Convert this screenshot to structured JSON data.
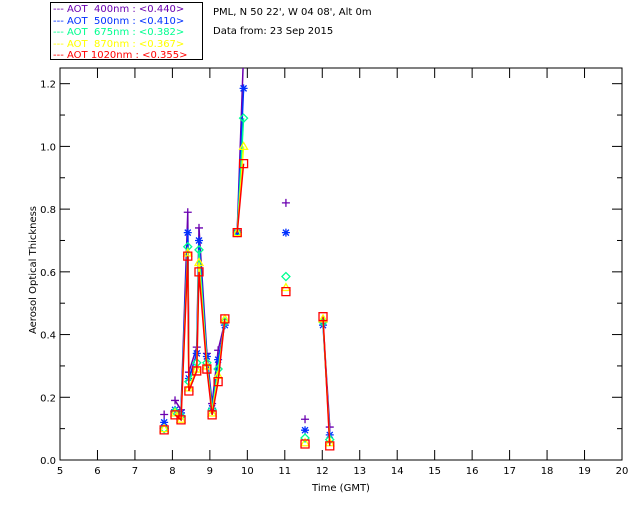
{
  "header": {
    "site": "PML, N 50 22', W 04 08', Alt 0m",
    "date": "Data from: 23 Sep 2015"
  },
  "legend": [
    {
      "label": "AOT  400nm : <0.440>",
      "color": "#6a00b0"
    },
    {
      "label": "AOT  500nm : <0.410>",
      "color": "#0030ff"
    },
    {
      "label": "AOT  675nm : <0.382>",
      "color": "#00ff90"
    },
    {
      "label": "AOT  870nm : <0.367>",
      "color": "#ffff00"
    },
    {
      "label": "AOT 1020nm : <0.355>",
      "color": "#ff0000"
    }
  ],
  "chart_data": {
    "type": "line",
    "xlabel": "Time (GMT)",
    "ylabel": "Aerosol Optical Thickness",
    "xlim": [
      5,
      20
    ],
    "ylim": [
      0,
      1.25
    ],
    "xticks": [
      5,
      6,
      7,
      8,
      9,
      10,
      11,
      12,
      13,
      14,
      15,
      16,
      17,
      18,
      19,
      20
    ],
    "yticks": [
      "0.0",
      "0.2",
      "0.4",
      "0.6",
      "0.8",
      "1.0",
      "1.2"
    ],
    "grid": false,
    "x": [
      7.78,
      8.07,
      8.23,
      8.41,
      8.44,
      8.65,
      8.71,
      8.92,
      9.06,
      9.22,
      9.4,
      9.73,
      9.9,
      11.03,
      11.54,
      12.02,
      12.2
    ],
    "connected_segments": [
      [
        1,
        10
      ],
      [
        11,
        12
      ],
      [
        15,
        16
      ]
    ],
    "series": [
      {
        "name": "AOT  400nm",
        "marker": "plus",
        "color": "#6a00b0",
        "values": [
          0.145,
          0.19,
          0.16,
          0.79,
          0.28,
          0.36,
          0.74,
          0.34,
          0.18,
          0.35,
          0.44,
          0.73,
          1.3,
          0.82,
          0.13,
          0.44,
          0.105
        ]
      },
      {
        "name": "AOT  500nm",
        "marker": "asterisk",
        "color": "#0030ff",
        "values": [
          0.12,
          0.16,
          0.15,
          0.725,
          0.26,
          0.34,
          0.7,
          0.33,
          0.165,
          0.32,
          0.43,
          0.725,
          1.185,
          0.725,
          0.095,
          0.43,
          0.08
        ]
      },
      {
        "name": "AOT  675nm",
        "marker": "diamond",
        "color": "#00ff90",
        "values": [
          0.1,
          0.155,
          0.14,
          0.68,
          0.25,
          0.31,
          0.67,
          0.31,
          0.16,
          0.29,
          0.44,
          0.725,
          1.09,
          0.585,
          0.07,
          0.44,
          0.065
        ]
      },
      {
        "name": "AOT  870nm",
        "marker": "triangle",
        "color": "#ffff00",
        "values": [
          0.1,
          0.15,
          0.13,
          0.66,
          0.23,
          0.29,
          0.63,
          0.3,
          0.15,
          0.27,
          0.45,
          0.725,
          1.0,
          0.55,
          0.055,
          0.45,
          0.055
        ]
      },
      {
        "name": "AOT 1020nm",
        "marker": "square",
        "color": "#ff0000",
        "values": [
          0.096,
          0.144,
          0.128,
          0.65,
          0.22,
          0.284,
          0.6,
          0.29,
          0.144,
          0.25,
          0.45,
          0.725,
          0.945,
          0.537,
          0.051,
          0.457,
          0.045
        ]
      }
    ]
  }
}
